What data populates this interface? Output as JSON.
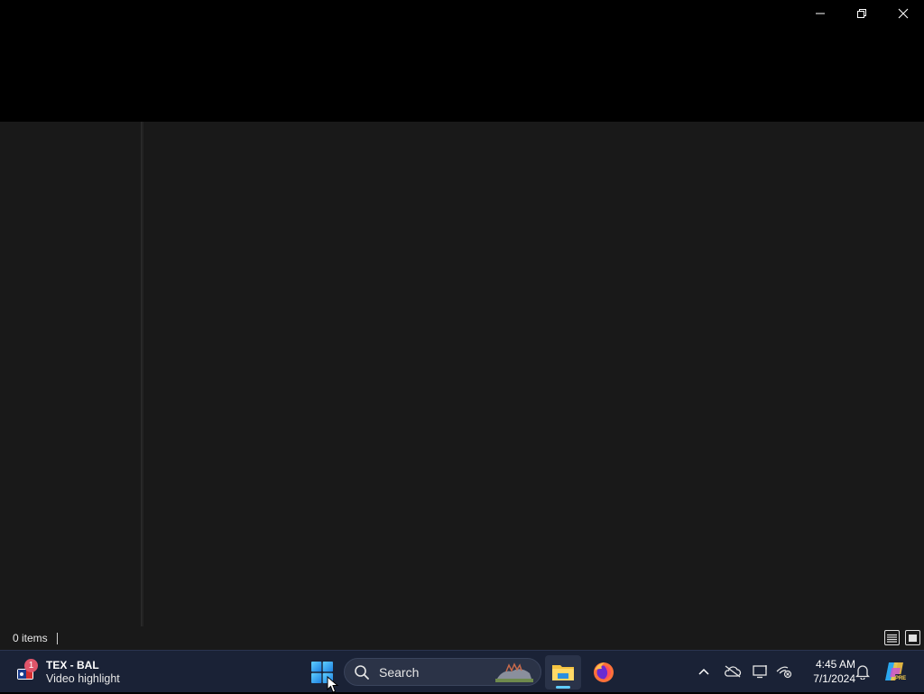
{
  "window": {
    "minimize_label": "Minimize",
    "restore_label": "Restore",
    "close_label": "Close"
  },
  "statusbar": {
    "item_count": "0 items"
  },
  "taskbar": {
    "widget": {
      "badge": "1",
      "title": "TEX - BAL",
      "subtitle": "Video highlight"
    },
    "search": {
      "placeholder": "Search"
    },
    "clock": {
      "time": "4:45 AM",
      "date": "7/1/2024"
    }
  },
  "colors": {
    "taskbar_bg": "#1a2236",
    "explorer_bg": "#191919",
    "accent": "#60cdff",
    "folder_yellow": "#f5c441"
  }
}
